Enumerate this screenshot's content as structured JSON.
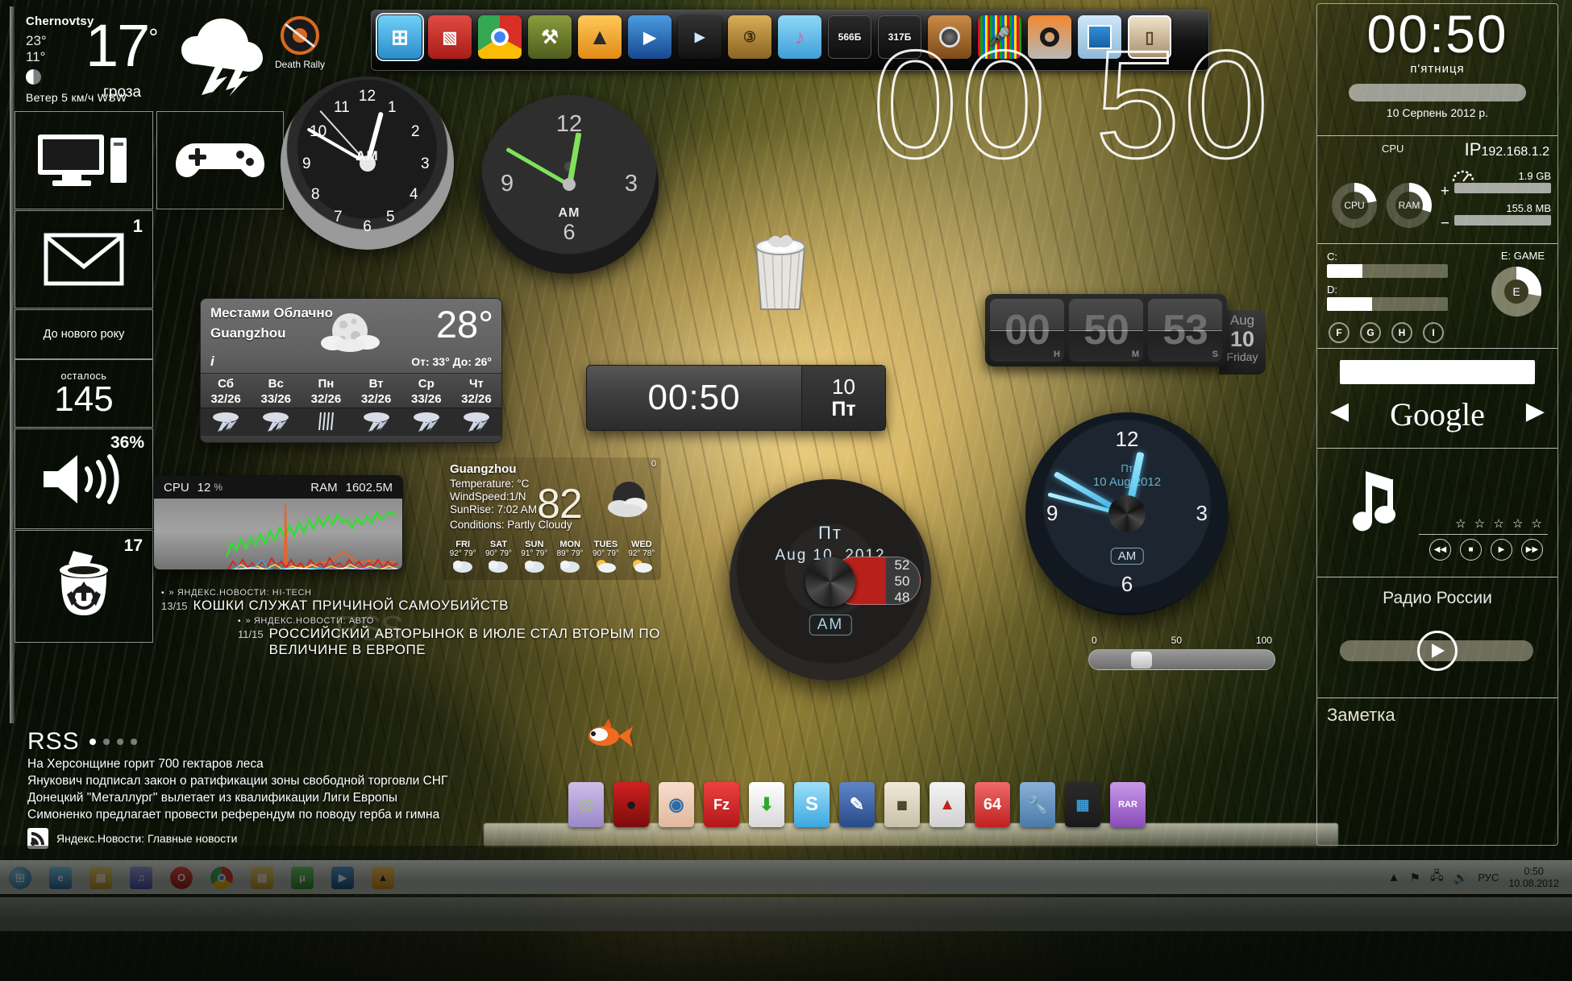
{
  "desktop": {
    "wallpaper_desc": "forest-sunbeams",
    "desktop_icon": {
      "label": "Death Rally",
      "icon": "game-disc-icon"
    }
  },
  "weather_top": {
    "city": "Chernovtsy",
    "high": "23°",
    "low": "11°",
    "moon_icon": "half-moon-icon",
    "wind": "Ветер  5 км/ч  WSW",
    "temperature": "17",
    "degree": "°",
    "condition": "гроза",
    "condition_icon": "thunderstorm-icon"
  },
  "metro_left": {
    "tiles": [
      {
        "name": "computer",
        "icon": "desktop-computer-icon",
        "label": ""
      },
      {
        "name": "games",
        "icon": "gamepad-icon",
        "label": ""
      },
      {
        "name": "mail",
        "icon": "envelope-icon",
        "count": "1"
      },
      {
        "name": "newyear",
        "title": "До нового року",
        "sub": "осталось",
        "value": "145"
      },
      {
        "name": "volume",
        "icon": "speaker-icon",
        "value": "36%"
      },
      {
        "name": "recycle-bin",
        "icon": "recycle-bin-icon",
        "count": "17"
      }
    ]
  },
  "top_dock": {
    "icons": [
      {
        "name": "windows-explorer",
        "glyph": "⊞",
        "color": "#3aa6e0",
        "selected": true
      },
      {
        "name": "photo-viewer",
        "glyph": "▧",
        "color": "#c92a26",
        "selected": false
      },
      {
        "name": "google-chrome",
        "glyph": "◉",
        "color": "#4dbb4d",
        "selected": false
      },
      {
        "name": "tools-wrench",
        "glyph": "⚒",
        "color": "#6a7a2c",
        "selected": false
      },
      {
        "name": "winamp",
        "glyph": "▲",
        "color": "#f0a32a",
        "selected": false
      },
      {
        "name": "media-player",
        "glyph": "▶",
        "color": "#2b6fbb",
        "selected": false
      },
      {
        "name": "video-editor",
        "glyph": "▶",
        "color": "#2f8fd0",
        "selected": false
      },
      {
        "name": "movie-reel",
        "glyph": "③",
        "color": "#c89a3e",
        "selected": false
      },
      {
        "name": "itunes-music",
        "glyph": "♪",
        "color": "#5ab4e8",
        "selected": false
      },
      {
        "name": "net-monitor-down",
        "glyph": "",
        "label": "566Б",
        "color": "#1b1b1b",
        "selected": false
      },
      {
        "name": "net-monitor-up",
        "glyph": "",
        "label": "317Б",
        "color": "#1b1b1b",
        "selected": false
      },
      {
        "name": "speaker-volume",
        "glyph": "◎",
        "color": "#b07a3a",
        "selected": false
      },
      {
        "name": "microphone-eq",
        "glyph": "🎤",
        "color": "#151515",
        "selected": false
      },
      {
        "name": "cd-burner",
        "glyph": "◎",
        "color": "#d96a1e",
        "selected": false
      },
      {
        "name": "blue-screen-app",
        "glyph": "▢",
        "color": "#2d8fd8",
        "selected": false
      },
      {
        "name": "photo-frame",
        "glyph": "▯",
        "color": "#d8c8a8",
        "selected": false
      }
    ]
  },
  "clock_white": {
    "hours": [
      "12",
      "1",
      "2",
      "3",
      "4",
      "5",
      "6",
      "7",
      "8",
      "9",
      "10",
      "11"
    ],
    "ampm": "AM",
    "hour_hand_deg": 15,
    "minute_hand_deg": 300,
    "second_hand_deg": 318
  },
  "clock_dark": {
    "marks": [
      "12",
      "3",
      "6",
      "9"
    ],
    "ampm": "AM",
    "hour_label_6": "6",
    "hour_hand_deg": 10,
    "minute_hand_deg": 300
  },
  "outline_clock": {
    "time": "00 50"
  },
  "weather_widget": {
    "condition": "Местами Облачно",
    "city": "Guangzhou",
    "temp": "28°",
    "range": "От: 33°  До: 26°",
    "info_icon": "info-icon",
    "moon_icon": "moon-cloud-icon",
    "forecast": [
      {
        "day": "Сб",
        "temps": "32/26",
        "icon": "thunderstorm-icon"
      },
      {
        "day": "Вс",
        "temps": "33/26",
        "icon": "thunderstorm-icon"
      },
      {
        "day": "Пн",
        "temps": "32/26",
        "icon": "rain-icon"
      },
      {
        "day": "Вт",
        "temps": "32/26",
        "icon": "thunderstorm-icon"
      },
      {
        "day": "Ср",
        "temps": "33/26",
        "icon": "thunderstorm-icon"
      },
      {
        "day": "Чт",
        "temps": "32/26",
        "icon": "thunderstorm-icon"
      }
    ]
  },
  "cpu_ram": {
    "cpu_label": "CPU",
    "cpu_value": "12",
    "cpu_unit": "%",
    "ram_label": "RAM",
    "ram_value": "1602.5M"
  },
  "guangzhou": {
    "title": "Guangzhou",
    "temperature_line": "Temperature: °C",
    "windspeed_line": "WindSpeed:1/N",
    "sunrise_line": "SunRise: 7:02 AM",
    "conditions_line": "Conditions: Partly Cloudy",
    "big_value": "82",
    "corner_mark": "0",
    "icon": "moon-cloud-icon",
    "forecast": [
      {
        "day": "FRI",
        "hi": "92°",
        "lo": "79°",
        "icon": "cloud-icon"
      },
      {
        "day": "SAT",
        "hi": "90°",
        "lo": "79°",
        "icon": "cloud-icon"
      },
      {
        "day": "SUN",
        "hi": "91°",
        "lo": "79°",
        "icon": "cloud-icon"
      },
      {
        "day": "MON",
        "hi": "89°",
        "lo": "79°",
        "icon": "cloud-icon"
      },
      {
        "day": "TUES",
        "hi": "90°",
        "lo": "79°",
        "icon": "sun-cloud-icon"
      },
      {
        "day": "WED",
        "hi": "92°",
        "lo": "78°",
        "icon": "sun-cloud-icon"
      }
    ]
  },
  "digital_bar": {
    "time": "00:50",
    "day_num": "10",
    "day_name": "Пт"
  },
  "flip_clock": {
    "hours": "00",
    "hours_unit": "H",
    "minutes": "50",
    "minutes_unit": "M",
    "seconds": "53",
    "seconds_unit": "S",
    "month": "Aug",
    "day": "10",
    "weekday": "Friday"
  },
  "vinyl_clock": {
    "weekday": "Пт",
    "date": "Aug  10, 2012",
    "ampm": "AM",
    "gauge": [
      "52",
      "50",
      "48"
    ]
  },
  "clock_blue": {
    "nums": {
      "n12": "12",
      "n3": "3",
      "n6": "6",
      "n9": "9"
    },
    "weekday": "Пт",
    "date": "10 Aug 2012",
    "ampm": "AM",
    "hour_hand_deg": 12,
    "minute_hand_deg": 300,
    "second_hand_deg": 285
  },
  "volume_slider": {
    "min": "0",
    "mid": "50",
    "max": "100",
    "value": 36
  },
  "rss_ticker": {
    "items": [
      {
        "source": "» ЯНДЕКС.НОВОСТИ: HI-TECH",
        "count": "13/15",
        "headline": "КОШКИ СЛУЖАТ ПРИЧИНОЙ САМОУБИЙСТВ"
      },
      {
        "source": "» ЯНДЕКС.НОВОСТИ: АВТО",
        "count": "11/15",
        "headline": "РОССИЙСКИЙ АВТОРЫНОК В ИЮЛЕ СТАЛ ВТОРЫМ ПО ВЕЛИЧИНЕ В ЕВРОПЕ"
      }
    ],
    "watermark": "RSS"
  },
  "rss_panel": {
    "title": "RSS",
    "headlines": [
      "На Херсонщине горит 700 гектаров леса",
      "Янукович подписал закон о ратификации зоны свободной торговли СНГ",
      "Донецкий \"Металлург\" вылетает из квалификации Лиги Европы",
      "Симоненко предлагает провести референдум по поводу герба и гимна"
    ],
    "footer": "Яндекс.Новости: Главные новости",
    "footer_icon": "rss-icon",
    "active_dot": 0,
    "dot_count": 4
  },
  "right_panel": {
    "clock": {
      "time": "00:50",
      "weekday": "п'ятниця",
      "date": "10 Серпень 2012 р."
    },
    "system": {
      "cpu_label": "CPU",
      "cpu_ring": "CPU",
      "ram_ring": "RAM",
      "ip_prefix": "IP",
      "ip": "192.168.1.2",
      "gauge_icon": "speedometer-icon",
      "down_value": "1.9 GB",
      "down_sign": "+",
      "up_value": "155.8 MB",
      "up_sign": "−",
      "cpu_pct": 22,
      "ram_pct": 30
    },
    "disks": {
      "c_label": "C:",
      "c_pct": 29,
      "d_label": "D:",
      "d_pct": 37,
      "e_label": "E: GAME",
      "e_letter": "E",
      "e_pct": 28,
      "letters": [
        "F",
        "G",
        "H",
        "I"
      ]
    },
    "search": {
      "engine": "Google",
      "value": "",
      "prev_icon": "chevron-left-icon",
      "next_icon": "chevron-right-icon"
    },
    "music": {
      "note_icon": "music-note-icon",
      "stars": "☆ ☆ ☆ ☆ ☆",
      "controls": [
        "prev-icon",
        "stop-icon",
        "play-icon",
        "next-icon"
      ]
    },
    "radio": {
      "station": "Радио России",
      "play_icon": "play-icon"
    },
    "note": {
      "title": "Заметка",
      "body": ""
    }
  },
  "bottom_dock": {
    "icons": [
      {
        "name": "pidgin",
        "glyph": "☺",
        "color": "#b9a7d6"
      },
      {
        "name": "ladybug-app",
        "glyph": "●",
        "color": "#a81616"
      },
      {
        "name": "eye-viewer",
        "glyph": "◉",
        "color": "#f0cfc0"
      },
      {
        "name": "filezilla",
        "glyph": "Fz",
        "color": "#e03434"
      },
      {
        "name": "download-manager",
        "glyph": "⬇",
        "color": "#f2f2f2"
      },
      {
        "name": "skype",
        "glyph": "S",
        "color": "#4fb8e8"
      },
      {
        "name": "notepad-pen",
        "glyph": "✎",
        "color": "#3c5fa8"
      },
      {
        "name": "calculator",
        "glyph": "0",
        "color": "#ded9c6"
      },
      {
        "name": "rocket-launcher",
        "glyph": "🚀",
        "color": "#e8e8e8"
      },
      {
        "name": "64bit-app",
        "glyph": "64",
        "color": "#e05050"
      },
      {
        "name": "tools-settings",
        "glyph": "🔧",
        "color": "#6a8fb8"
      },
      {
        "name": "window-tiler",
        "glyph": "▦",
        "color": "#3a7ab8"
      },
      {
        "name": "winrar",
        "glyph": "RAR",
        "color": "#a46ad0"
      }
    ]
  },
  "taskbar": {
    "start_icon": "start-orb-icon",
    "buttons": [
      {
        "name": "internet-explorer",
        "glyph": "e",
        "color": "#2f8ed0"
      },
      {
        "name": "file-explorer",
        "glyph": "▤",
        "color": "#e8c05a"
      },
      {
        "name": "media-library",
        "glyph": "♫",
        "color": "#6a6ad0"
      },
      {
        "name": "opera",
        "glyph": "O",
        "color": "#d02020"
      },
      {
        "name": "chrome",
        "glyph": "◉",
        "color": "#4dbb4d"
      },
      {
        "name": "folder-window",
        "glyph": "▤",
        "color": "#d8b048"
      },
      {
        "name": "utorrent",
        "glyph": "μ",
        "color": "#4aa84a"
      },
      {
        "name": "media-player-task",
        "glyph": "▶",
        "color": "#2b6fbb"
      },
      {
        "name": "winamp-task",
        "glyph": "▲",
        "color": "#f0a32a"
      }
    ],
    "tray": {
      "show_hidden_icon": "chevron-up-icon",
      "network_icon": "network-flag-icon",
      "monitor_icon": "monitor-icon",
      "volume_icon": "volume-icon",
      "language": "РУС",
      "time": "0:50",
      "date": "10.08.2012"
    }
  }
}
